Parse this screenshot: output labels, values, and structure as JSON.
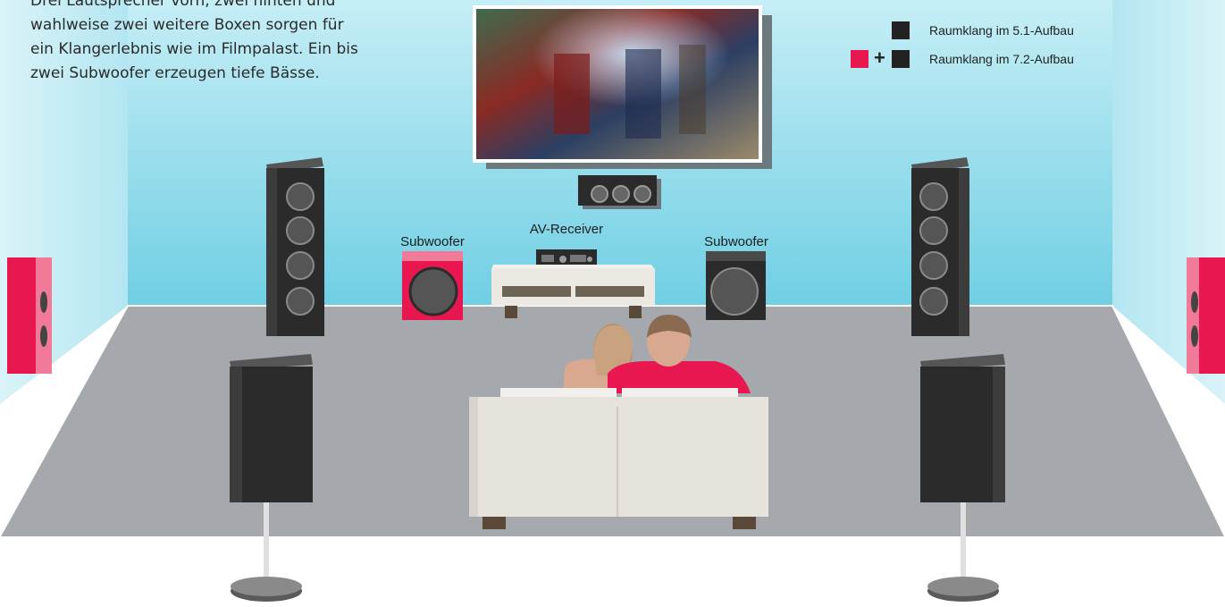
{
  "intro": {
    "line1": "Drei Lautsprecher vorn, zwei hinten und",
    "line2": "wahlweise zwei weitere Boxen sorgen für",
    "line3": "ein Klangerlebnis wie im Filmpalast. Ein bis",
    "line4": "zwei Subwoofer erzeugen tiefe Bässe."
  },
  "legend": {
    "item1": {
      "label": "Raumklang im 5.1-Aufbau",
      "color": "#222222"
    },
    "item2": {
      "label": "Raumklang im 7.2-Aufbau",
      "plus": "+",
      "color_extra": "#e8174f",
      "color": "#222222"
    }
  },
  "labels": {
    "subwoofer_left": "Subwoofer",
    "av_receiver": "AV-Receiver",
    "subwoofer_right": "Subwoofer"
  },
  "colors": {
    "wall": "#7fd6e8",
    "floor": "#a5a9ad",
    "speaker_dark": "#2b2b2b",
    "speaker_accent": "#e8174f",
    "sofa": "#e6e2dc"
  }
}
